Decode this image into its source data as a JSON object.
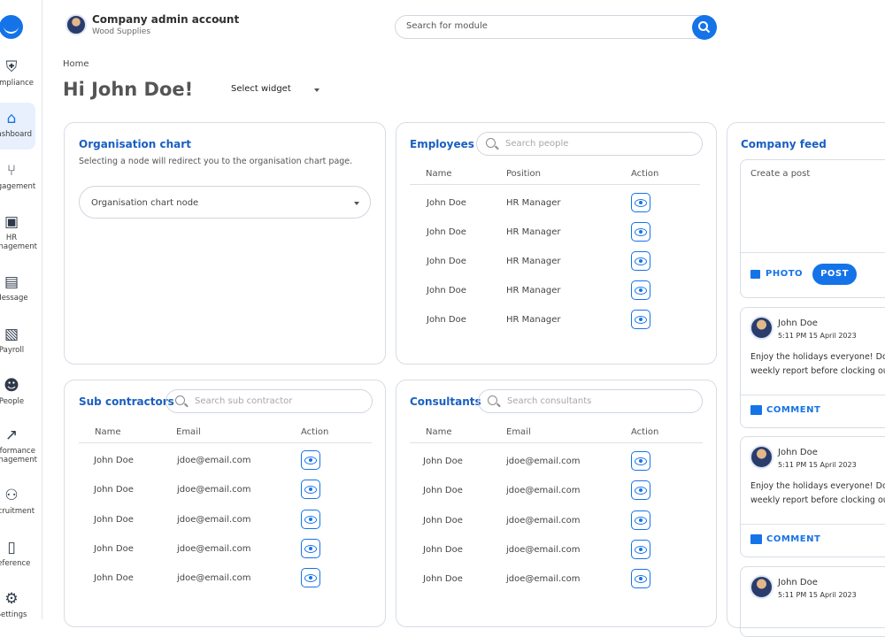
{
  "app": {
    "accent": "#1573e8"
  },
  "sidebar": {
    "items": [
      {
        "label": "Compliance",
        "icon": "shield-check-icon"
      },
      {
        "label": "Dashboard",
        "icon": "home-icon"
      },
      {
        "label": "Engagement",
        "icon": "share-icon"
      },
      {
        "label1": "HR",
        "label2": "Management",
        "icon": "hr-icon"
      },
      {
        "label": "Message",
        "icon": "message-icon"
      },
      {
        "label": "Payroll",
        "icon": "payroll-icon"
      },
      {
        "label": "People",
        "icon": "people-icon"
      },
      {
        "label1": "Performance",
        "label2": "Management",
        "icon": "performance-icon"
      },
      {
        "label": "Recruitment",
        "icon": "recruitment-icon"
      },
      {
        "label": "Reference",
        "icon": "book-icon"
      },
      {
        "label": "Settings",
        "icon": "gear-icon"
      }
    ]
  },
  "header": {
    "account_name": "Company admin account",
    "company": "Wood Supplies",
    "search_placeholder": "Search for module"
  },
  "breadcrumb": "Home",
  "greeting": "Hi John Doe!",
  "widget_select": "Select widget",
  "org_chart": {
    "title": "Organisation chart",
    "description": "Selecting a node will redirect you to the organisation chart page.",
    "select_value": "Organisation chart node"
  },
  "employees": {
    "title": "Employees",
    "search_placeholder": "Search people",
    "columns": [
      "Name",
      "Position",
      "Action"
    ],
    "rows": [
      {
        "name": "John Doe",
        "position": "HR Manager"
      },
      {
        "name": "John Doe",
        "position": "HR Manager"
      },
      {
        "name": "John Doe",
        "position": "HR Manager"
      },
      {
        "name": "John Doe",
        "position": "HR Manager"
      },
      {
        "name": "John Doe",
        "position": "HR Manager"
      }
    ]
  },
  "subcontractors": {
    "title": "Sub contractors",
    "search_placeholder": "Search sub contractor",
    "columns": [
      "Name",
      "Email",
      "Action"
    ],
    "rows": [
      {
        "name": "John Doe",
        "email": "jdoe@email.com"
      },
      {
        "name": "John Doe",
        "email": "jdoe@email.com"
      },
      {
        "name": "John Doe",
        "email": "jdoe@email.com"
      },
      {
        "name": "John Doe",
        "email": "jdoe@email.com"
      },
      {
        "name": "John Doe",
        "email": "jdoe@email.com"
      }
    ]
  },
  "consultants": {
    "title": "Consultants",
    "search_placeholder": "Search consultants",
    "columns": [
      "Name",
      "Email",
      "Action"
    ],
    "rows": [
      {
        "name": "John Doe",
        "email": "jdoe@email.com"
      },
      {
        "name": "John Doe",
        "email": "jdoe@email.com"
      },
      {
        "name": "John Doe",
        "email": "jdoe@email.com"
      },
      {
        "name": "John Doe",
        "email": "jdoe@email.com"
      },
      {
        "name": "John Doe",
        "email": "jdoe@email.com"
      }
    ]
  },
  "feed": {
    "title": "Company feed",
    "post_placeholder": "Create a post",
    "photo_label": "PHOTO",
    "post_label": "POST",
    "comment_label": "COMMENT",
    "posts": [
      {
        "author": "John Doe",
        "time": "5:11 PM 15 April 2023",
        "line1": "Enjoy the holidays everyone! Do",
        "line2": "weekly report before clocking ou"
      },
      {
        "author": "John Doe",
        "time": "5:11 PM 15 April 2023",
        "line1": "Enjoy the holidays everyone! Do",
        "line2": "weekly report before clocking ou"
      },
      {
        "author": "John Doe",
        "time": "5:11 PM 15 April 2023"
      }
    ]
  }
}
